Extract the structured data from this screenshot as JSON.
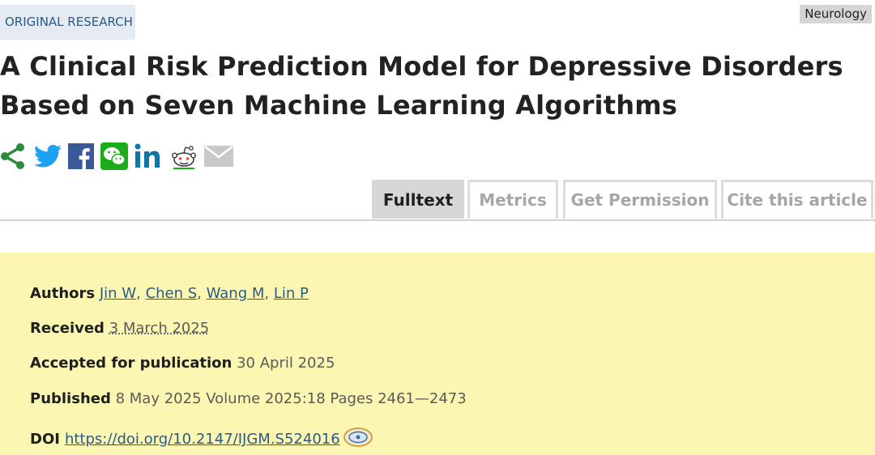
{
  "header": {
    "article_type": "ORIGINAL RESEARCH",
    "subject": "Neurology",
    "title": "A Clinical Risk Prediction Model for Depressive Disorders Based on Seven Machine Learning Algorithms"
  },
  "share_icons": [
    "share-icon",
    "twitter-icon",
    "facebook-icon",
    "wechat-icon",
    "linkedin-icon",
    "reddit-icon",
    "email-icon"
  ],
  "tabs": [
    {
      "label": "Fulltext",
      "active": true
    },
    {
      "label": "Metrics",
      "active": false
    },
    {
      "label": "Get Permission",
      "active": false
    },
    {
      "label": "Cite this article",
      "active": false
    }
  ],
  "meta": {
    "authors_label": "Authors",
    "authors": [
      "Jin W",
      "Chen S",
      "Wang M",
      "Lin P"
    ],
    "received_label": "Received",
    "received": "3 March 2025",
    "accepted_label": "Accepted for publication",
    "accepted": "30 April 2025",
    "published_label": "Published",
    "published": "8 May 2025 Volume 2025:18 Pages 2461—2473",
    "doi_label": "DOI",
    "doi": "https://doi.org/10.2147/IJGM.S524016"
  },
  "colors": {
    "meta_background": "#fbf7b3",
    "link": "#2b5a86",
    "twitter": "#1da1f2",
    "facebook": "#3b5998",
    "wechat": "#1aad19",
    "linkedin": "#0e76a8",
    "share": "#2e8b3d"
  }
}
